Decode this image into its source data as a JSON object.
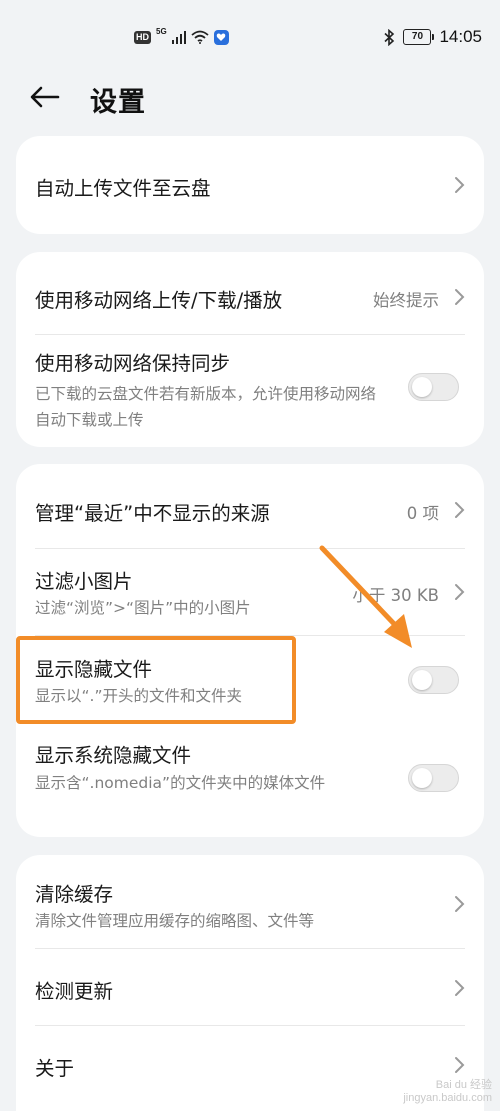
{
  "status_bar": {
    "hd": "HD",
    "network": "5G",
    "battery": "70",
    "time": "14:05",
    "icons": [
      "hd-icon",
      "5g-signal-icon",
      "wifi-icon",
      "notification-badge-icon",
      "bluetooth-icon",
      "battery-icon"
    ]
  },
  "header": {
    "back_icon": "back-arrow-icon",
    "title": "设置"
  },
  "card1": {
    "auto_upload": {
      "title": "自动上传文件至云盘",
      "icon": "chevron-right-icon"
    }
  },
  "card2": {
    "mobile_upload": {
      "title": "使用移动网络上传/下载/播放",
      "value": "始终提示",
      "icon": "chevron-right-icon"
    },
    "mobile_sync": {
      "title": "使用移动网络保持同步",
      "subtitle": "已下载的云盘文件若有新版本，允许使用移动网络自动下载或上传",
      "enabled": false
    }
  },
  "card3": {
    "recent_sources": {
      "title": "管理“最近”中不显示的来源",
      "value": "0 项",
      "icon": "chevron-right-icon"
    },
    "filter_small": {
      "title": "过滤小图片",
      "subtitle": "过滤“浏览”>“图片”中的小图片",
      "value": "小于 30 KB",
      "icon": "chevron-right-icon"
    },
    "show_hidden": {
      "title": "显示隐藏文件",
      "subtitle": "显示以“.”开头的文件和文件夹",
      "enabled": false
    },
    "show_system_hidden": {
      "title": "显示系统隐藏文件",
      "subtitle": "显示含“.nomedia”的文件夹中的媒体文件",
      "enabled": false
    }
  },
  "card4": {
    "clear_cache": {
      "title": "清除缓存",
      "subtitle": "清除文件管理应用缓存的缩略图、文件等",
      "icon": "chevron-right-icon"
    },
    "check_update": {
      "title": "检测更新",
      "icon": "chevron-right-icon"
    },
    "about": {
      "title": "关于",
      "icon": "chevron-right-icon"
    }
  },
  "annotation": {
    "highlight_color": "#f28c28",
    "arrow_color": "#f28c28"
  },
  "watermark": {
    "line1": "Bai du 经验",
    "line2": "jingyan.baidu.com"
  }
}
